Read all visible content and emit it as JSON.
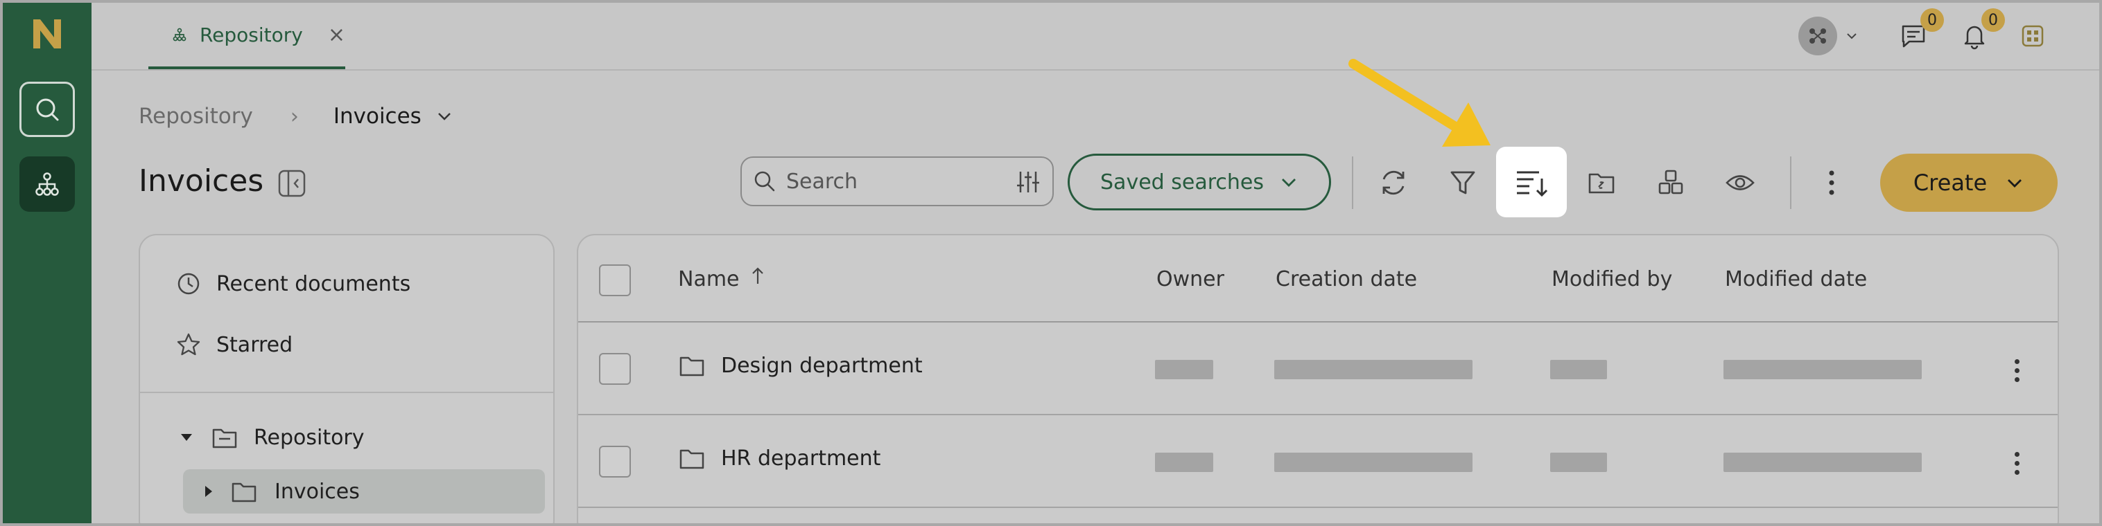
{
  "tab": {
    "label": "Repository",
    "close": "×"
  },
  "notifications": {
    "messages_count": "0",
    "alerts_count": "0"
  },
  "breadcrumb": {
    "root": "Repository",
    "separator": "›",
    "current": "Invoices"
  },
  "page": {
    "title": "Invoices"
  },
  "search": {
    "placeholder": "Search"
  },
  "toolbar": {
    "saved_searches": "Saved searches",
    "create": "Create",
    "icons": [
      "refresh-icon",
      "filter-icon",
      "sort-icon",
      "folder-link-icon",
      "grid-icon",
      "eye-icon",
      "more-vertical-icon"
    ]
  },
  "left_panel": {
    "recent": "Recent documents",
    "starred": "Starred",
    "tree": [
      {
        "label": "Repository",
        "expanded": true
      },
      {
        "label": "Invoices",
        "expanded": false,
        "selected": true
      }
    ]
  },
  "table": {
    "columns": [
      "Name",
      "Owner",
      "Creation date",
      "Modified by",
      "Modified date"
    ],
    "sort_column": "Name",
    "sort_direction": "ascending",
    "rows": [
      {
        "name": "Design department"
      },
      {
        "name": "HR department"
      }
    ]
  },
  "colors": {
    "brand_green": "#265a3d",
    "accent_gold": "#c5a048",
    "annotation_arrow": "#f3c020"
  }
}
